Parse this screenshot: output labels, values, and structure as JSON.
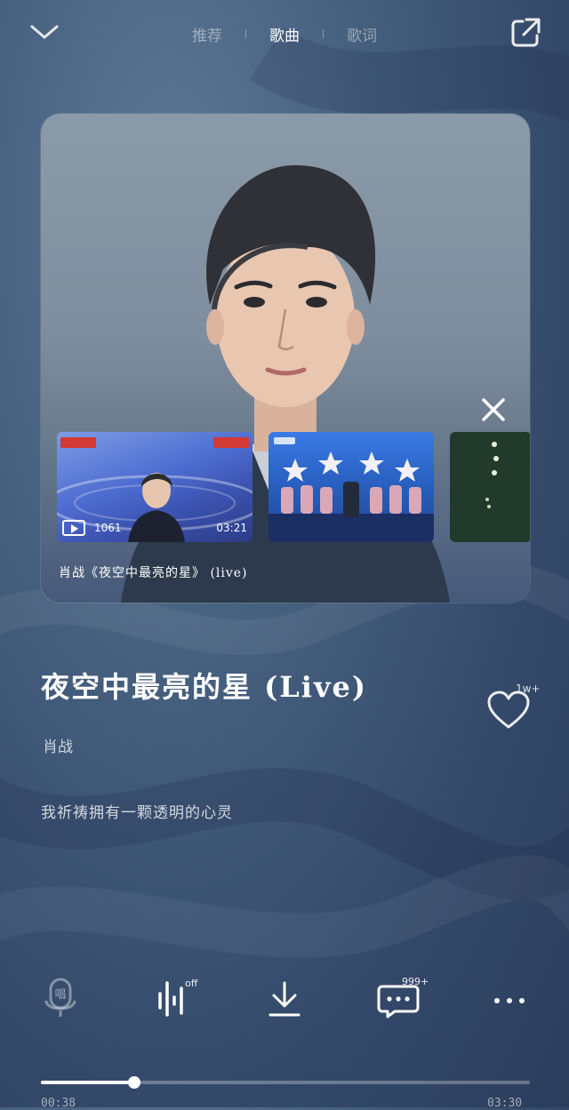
{
  "header": {
    "tabs": [
      {
        "label": "推荐",
        "active": false
      },
      {
        "label": "歌曲",
        "active": true
      },
      {
        "label": "歌词",
        "active": false
      }
    ]
  },
  "video_panel": {
    "thumbnails": [
      {
        "views": "1061",
        "duration": "03:21"
      },
      {
        "views": "",
        "duration": ""
      },
      {
        "views": "",
        "duration": ""
      }
    ],
    "caption": "肖战《夜空中最亮的星》 (live)"
  },
  "song": {
    "title": "夜空中最亮的星 (Live)",
    "artist": "肖战",
    "current_lyric": "我祈祷拥有一颗透明的心灵",
    "like_count": "1w+"
  },
  "toolbar": {
    "sing_label": "唱",
    "effects_badge": "off",
    "comments_badge": "999+"
  },
  "player": {
    "progress": 0.19,
    "elapsed": "00:38",
    "total": "03:30"
  },
  "colors": {
    "background": "#46607f",
    "accent": "#ffffff"
  }
}
